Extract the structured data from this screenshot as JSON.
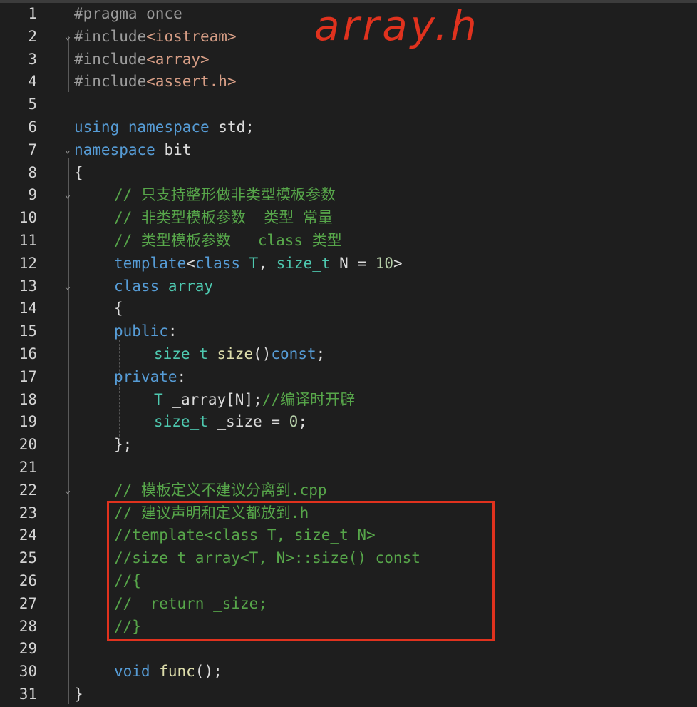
{
  "annotation": "array.h",
  "lines": [
    {
      "n": "1",
      "parts": [
        {
          "t": "#pragma ",
          "c": "pp"
        },
        {
          "t": "once",
          "c": "pp"
        }
      ]
    },
    {
      "n": "2",
      "fold": "⌄",
      "parts": [
        {
          "t": "#include",
          "c": "pp"
        },
        {
          "t": "<iostream>",
          "c": "str"
        }
      ]
    },
    {
      "n": "3",
      "parts": [
        {
          "t": "#include",
          "c": "pp"
        },
        {
          "t": "<array>",
          "c": "str"
        }
      ]
    },
    {
      "n": "4",
      "parts": [
        {
          "t": "#include",
          "c": "pp"
        },
        {
          "t": "<assert.h>",
          "c": "str"
        }
      ]
    },
    {
      "n": "5",
      "parts": []
    },
    {
      "n": "6",
      "parts": [
        {
          "t": "using ",
          "c": "kw"
        },
        {
          "t": "namespace ",
          "c": "kw"
        },
        {
          "t": "std;",
          "c": ""
        }
      ]
    },
    {
      "n": "7",
      "fold": "⌄",
      "parts": [
        {
          "t": "namespace ",
          "c": "kw"
        },
        {
          "t": "bit",
          "c": ""
        }
      ]
    },
    {
      "n": "8",
      "parts": [
        {
          "t": "{",
          "c": ""
        }
      ]
    },
    {
      "n": "9",
      "fold": "⌄",
      "indent": 1,
      "parts": [
        {
          "t": "// 只支持整形做非类型模板参数",
          "c": "cm"
        }
      ]
    },
    {
      "n": "10",
      "indent": 1,
      "parts": [
        {
          "t": "// 非类型模板参数  类型 常量",
          "c": "cm"
        }
      ]
    },
    {
      "n": "11",
      "indent": 1,
      "parts": [
        {
          "t": "// 类型模板参数   class 类型",
          "c": "cm"
        }
      ]
    },
    {
      "n": "12",
      "indent": 1,
      "parts": [
        {
          "t": "template",
          "c": "kw"
        },
        {
          "t": "<",
          "c": ""
        },
        {
          "t": "class ",
          "c": "kw"
        },
        {
          "t": "T",
          "c": "ty"
        },
        {
          "t": ", ",
          "c": ""
        },
        {
          "t": "size_t",
          "c": "ty"
        },
        {
          "t": " N = ",
          "c": ""
        },
        {
          "t": "10",
          "c": "num"
        },
        {
          "t": ">",
          "c": ""
        }
      ]
    },
    {
      "n": "13",
      "fold": "⌄",
      "indent": 1,
      "parts": [
        {
          "t": "class ",
          "c": "kw"
        },
        {
          "t": "array",
          "c": "ty"
        }
      ]
    },
    {
      "n": "14",
      "indent": 1,
      "parts": [
        {
          "t": "{",
          "c": ""
        }
      ]
    },
    {
      "n": "15",
      "indent": 1,
      "parts": [
        {
          "t": "public",
          "c": "kw"
        },
        {
          "t": ":",
          "c": ""
        }
      ]
    },
    {
      "n": "16",
      "indent": 2,
      "parts": [
        {
          "t": "size_t",
          "c": "ty"
        },
        {
          "t": " ",
          "c": ""
        },
        {
          "t": "size",
          "c": "fn"
        },
        {
          "t": "()",
          "c": ""
        },
        {
          "t": "const",
          "c": "kw"
        },
        {
          "t": ";",
          "c": ""
        }
      ]
    },
    {
      "n": "17",
      "indent": 1,
      "parts": [
        {
          "t": "private",
          "c": "kw"
        },
        {
          "t": ":",
          "c": ""
        }
      ]
    },
    {
      "n": "18",
      "indent": 2,
      "parts": [
        {
          "t": "T",
          "c": "ty"
        },
        {
          "t": " _array[N];",
          "c": ""
        },
        {
          "t": "//编译时开辟",
          "c": "cm"
        }
      ]
    },
    {
      "n": "19",
      "indent": 2,
      "parts": [
        {
          "t": "size_t",
          "c": "ty"
        },
        {
          "t": " _size = ",
          "c": ""
        },
        {
          "t": "0",
          "c": "num"
        },
        {
          "t": ";",
          "c": ""
        }
      ]
    },
    {
      "n": "20",
      "indent": 1,
      "parts": [
        {
          "t": "};",
          "c": ""
        }
      ]
    },
    {
      "n": "21",
      "parts": []
    },
    {
      "n": "22",
      "fold": "⌄",
      "indent": 1,
      "parts": [
        {
          "t": "// 模板定义不建议分离到.cpp",
          "c": "cm"
        }
      ]
    },
    {
      "n": "23",
      "indent": 1,
      "parts": [
        {
          "t": "// 建议声明和定义都放到.h",
          "c": "cm"
        }
      ]
    },
    {
      "n": "24",
      "indent": 1,
      "parts": [
        {
          "t": "//template<class T, size_t N>",
          "c": "cm"
        }
      ]
    },
    {
      "n": "25",
      "indent": 1,
      "parts": [
        {
          "t": "//size_t array<T, N>::size() const",
          "c": "cm"
        }
      ]
    },
    {
      "n": "26",
      "indent": 1,
      "parts": [
        {
          "t": "//{",
          "c": "cm"
        }
      ]
    },
    {
      "n": "27",
      "indent": 1,
      "parts": [
        {
          "t": "//  return _size;",
          "c": "cm"
        }
      ]
    },
    {
      "n": "28",
      "indent": 1,
      "parts": [
        {
          "t": "//}",
          "c": "cm"
        }
      ]
    },
    {
      "n": "29",
      "parts": []
    },
    {
      "n": "30",
      "indent": 1,
      "parts": [
        {
          "t": "void ",
          "c": "kw"
        },
        {
          "t": "func",
          "c": "fn"
        },
        {
          "t": "();",
          "c": ""
        }
      ]
    },
    {
      "n": "31",
      "parts": [
        {
          "t": "}",
          "c": ""
        }
      ]
    }
  ]
}
